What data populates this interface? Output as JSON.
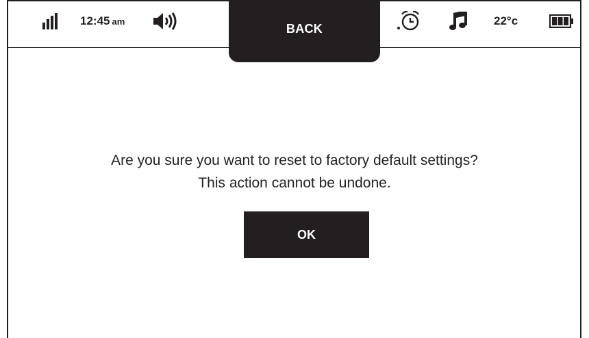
{
  "status_bar": {
    "signal_icon": "signal-bars-icon",
    "time": "12:45",
    "time_suffix": "am",
    "volume_icon": "speaker-volume-icon",
    "alarm_icon": "alarm-clock-icon",
    "music_icon": "music-note-icon",
    "temperature": "22°c",
    "battery_icon": "battery-full-icon"
  },
  "back_button": {
    "label": "BACK"
  },
  "dialog": {
    "line1": "Are you sure you want to reset to factory default settings?",
    "line2": "This action cannot be undone.",
    "ok_label": "OK"
  },
  "colors": {
    "ink": "#231f20",
    "background": "#ffffff"
  }
}
